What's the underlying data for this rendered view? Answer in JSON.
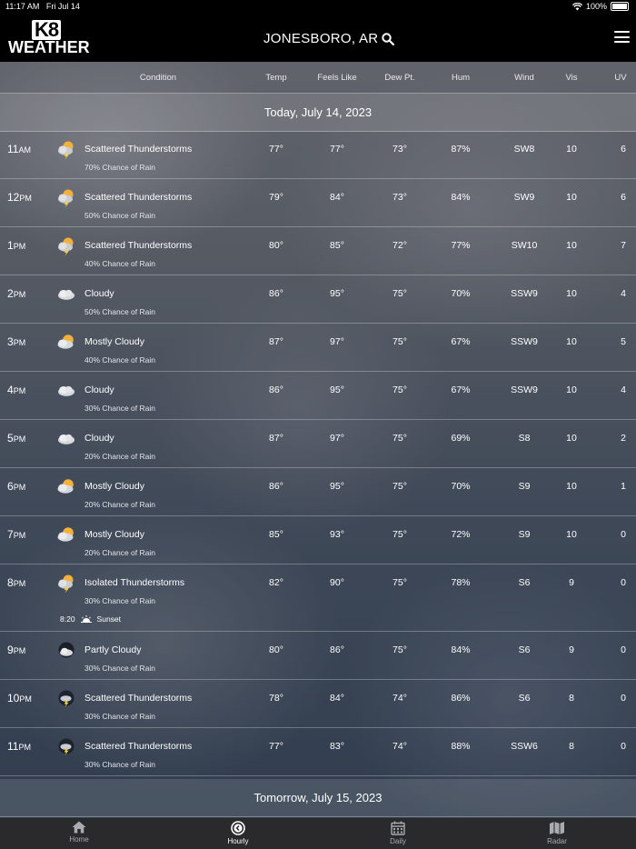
{
  "status": {
    "time": "11:17 AM",
    "date": "Fri Jul 14",
    "battery": "100%"
  },
  "header": {
    "logo_top": "K8",
    "logo_bottom": "WEATHER",
    "location": "JONESBORO, AR"
  },
  "columns": [
    "Condition",
    "Temp",
    "Feels Like",
    "Dew Pt.",
    "Hum",
    "Wind",
    "Vis",
    "UV"
  ],
  "today_label": "Today, July 14, 2023",
  "tomorrow_label": "Tomorrow, July 15, 2023",
  "rows": [
    {
      "hour": "11",
      "ampm": "AM",
      "icon": "thunderstorm-sun-icon",
      "condition": "Scattered Thunderstorms",
      "rain": "70% Chance of Rain",
      "temp": "77°",
      "feels": "77°",
      "dew": "73°",
      "hum": "87%",
      "wind": "SW8",
      "vis": "10",
      "uv": "6"
    },
    {
      "hour": "12",
      "ampm": "PM",
      "icon": "thunderstorm-sun-icon",
      "condition": "Scattered Thunderstorms",
      "rain": "50% Chance of Rain",
      "temp": "79°",
      "feels": "84°",
      "dew": "73°",
      "hum": "84%",
      "wind": "SW9",
      "vis": "10",
      "uv": "6"
    },
    {
      "hour": "1",
      "ampm": "PM",
      "icon": "thunderstorm-sun-icon",
      "condition": "Scattered Thunderstorms",
      "rain": "40% Chance of Rain",
      "temp": "80°",
      "feels": "85°",
      "dew": "72°",
      "hum": "77%",
      "wind": "SW10",
      "vis": "10",
      "uv": "7"
    },
    {
      "hour": "2",
      "ampm": "PM",
      "icon": "cloud-icon",
      "condition": "Cloudy",
      "rain": "50% Chance of Rain",
      "temp": "86°",
      "feels": "95°",
      "dew": "75°",
      "hum": "70%",
      "wind": "SSW9",
      "vis": "10",
      "uv": "4"
    },
    {
      "hour": "3",
      "ampm": "PM",
      "icon": "mostly-cloudy-icon",
      "condition": "Mostly Cloudy",
      "rain": "40% Chance of Rain",
      "temp": "87°",
      "feels": "97°",
      "dew": "75°",
      "hum": "67%",
      "wind": "SSW9",
      "vis": "10",
      "uv": "5"
    },
    {
      "hour": "4",
      "ampm": "PM",
      "icon": "cloud-icon",
      "condition": "Cloudy",
      "rain": "30% Chance of Rain",
      "temp": "86°",
      "feels": "95°",
      "dew": "75°",
      "hum": "67%",
      "wind": "SSW9",
      "vis": "10",
      "uv": "4"
    },
    {
      "hour": "5",
      "ampm": "PM",
      "icon": "cloud-icon",
      "condition": "Cloudy",
      "rain": "20% Chance of Rain",
      "temp": "87°",
      "feels": "97°",
      "dew": "75°",
      "hum": "69%",
      "wind": "S8",
      "vis": "10",
      "uv": "2"
    },
    {
      "hour": "6",
      "ampm": "PM",
      "icon": "mostly-cloudy-icon",
      "condition": "Mostly Cloudy",
      "rain": "20% Chance of Rain",
      "temp": "86°",
      "feels": "95°",
      "dew": "75°",
      "hum": "70%",
      "wind": "S9",
      "vis": "10",
      "uv": "1"
    },
    {
      "hour": "7",
      "ampm": "PM",
      "icon": "mostly-cloudy-icon",
      "condition": "Mostly Cloudy",
      "rain": "20% Chance of Rain",
      "temp": "85°",
      "feels": "93°",
      "dew": "75°",
      "hum": "72%",
      "wind": "S9",
      "vis": "10",
      "uv": "0"
    },
    {
      "hour": "8",
      "ampm": "PM",
      "icon": "thunderstorm-sun-icon",
      "condition": "Isolated Thunderstorms",
      "rain": "30% Chance of Rain",
      "temp": "82°",
      "feels": "90°",
      "dew": "75°",
      "hum": "78%",
      "wind": "S6",
      "vis": "9",
      "uv": "0",
      "sunset_time": "8:20",
      "sunset_label": "Sunset"
    },
    {
      "hour": "9",
      "ampm": "PM",
      "icon": "partly-cloudy-night-icon",
      "condition": "Partly Cloudy",
      "rain": "30% Chance of Rain",
      "temp": "80°",
      "feels": "86°",
      "dew": "75°",
      "hum": "84%",
      "wind": "S6",
      "vis": "9",
      "uv": "0"
    },
    {
      "hour": "10",
      "ampm": "PM",
      "icon": "thunderstorm-night-icon",
      "condition": "Scattered Thunderstorms",
      "rain": "30% Chance of Rain",
      "temp": "78°",
      "feels": "84°",
      "dew": "74°",
      "hum": "86%",
      "wind": "S6",
      "vis": "8",
      "uv": "0"
    },
    {
      "hour": "11",
      "ampm": "PM",
      "icon": "thunderstorm-night-icon",
      "condition": "Scattered Thunderstorms",
      "rain": "30% Chance of Rain",
      "temp": "77°",
      "feels": "83°",
      "dew": "74°",
      "hum": "88%",
      "wind": "SSW6",
      "vis": "8",
      "uv": "0"
    }
  ],
  "tabs": [
    {
      "label": "Home",
      "icon": "home-icon",
      "active": false
    },
    {
      "label": "Hourly",
      "icon": "clock-icon",
      "active": true
    },
    {
      "label": "Daily",
      "icon": "calendar-icon",
      "active": false
    },
    {
      "label": "Radar",
      "icon": "map-icon",
      "active": false
    }
  ]
}
